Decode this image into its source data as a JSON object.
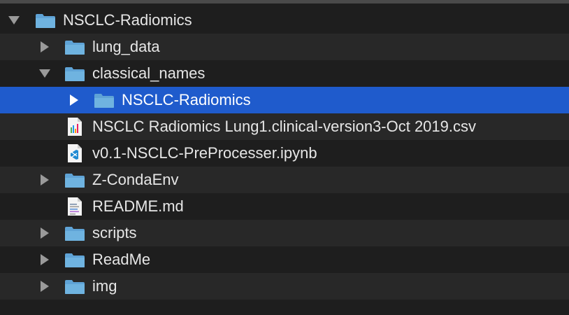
{
  "colors": {
    "background": "#1e1e1e",
    "stripe": "#282828",
    "selection": "#1f5bcc",
    "folder": "#6fb3e0",
    "folder_tab": "#5fa3d6",
    "text": "#e6e6e6"
  },
  "tree": {
    "items": [
      {
        "label": "NSCLC-Radiomics",
        "kind": "folder",
        "state": "expanded",
        "icon": "folder-icon"
      },
      {
        "label": "lung_data",
        "kind": "folder",
        "state": "collapsed",
        "icon": "folder-icon"
      },
      {
        "label": "classical_names",
        "kind": "folder",
        "state": "expanded",
        "icon": "folder-icon"
      },
      {
        "label": "NSCLC-Radiomics",
        "kind": "folder",
        "state": "collapsed",
        "selected": true,
        "icon": "folder-icon"
      },
      {
        "label": "NSCLC Radiomics Lung1.clinical-version3-Oct 2019.csv",
        "kind": "file",
        "icon": "csv-file-icon"
      },
      {
        "label": "v0.1-NSCLC-PreProcesser.ipynb",
        "kind": "file",
        "icon": "vscode-file-icon"
      },
      {
        "label": "Z-CondaEnv",
        "kind": "folder",
        "state": "collapsed",
        "icon": "folder-icon"
      },
      {
        "label": "README.md",
        "kind": "file",
        "icon": "markdown-file-icon"
      },
      {
        "label": "scripts",
        "kind": "folder",
        "state": "collapsed",
        "icon": "folder-icon"
      },
      {
        "label": "ReadMe",
        "kind": "folder",
        "state": "collapsed",
        "icon": "folder-icon"
      },
      {
        "label": "img",
        "kind": "folder",
        "state": "collapsed",
        "icon": "folder-icon"
      }
    ]
  }
}
